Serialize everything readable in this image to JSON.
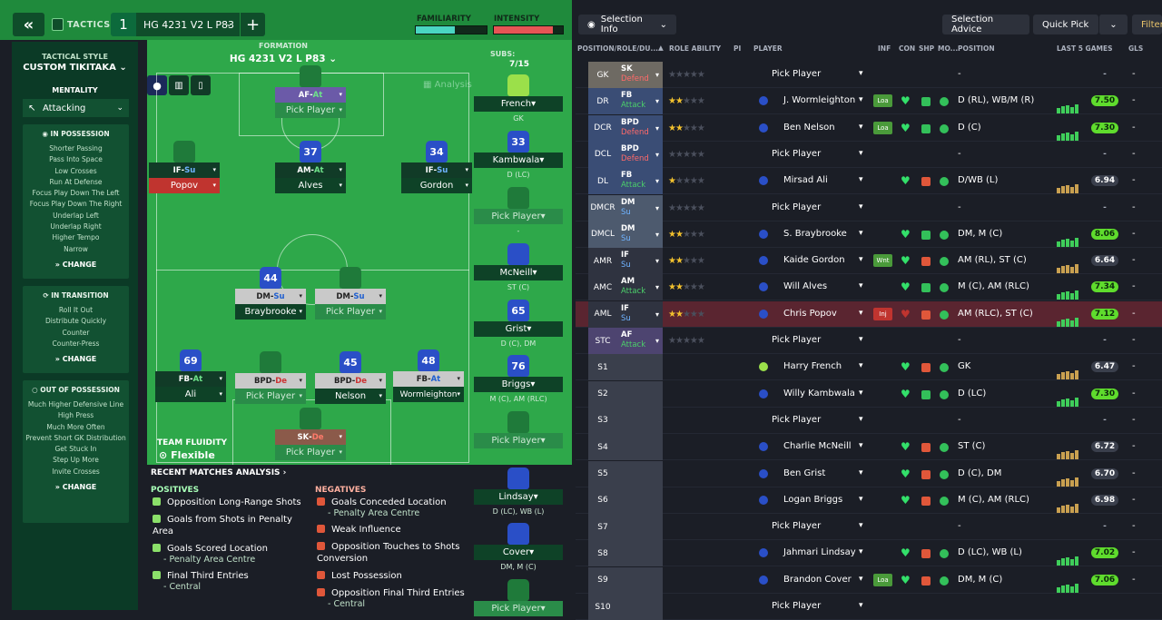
{
  "topbar": {
    "tactics_label": "TACTICS",
    "tactic_num": "1",
    "tactic_name": "HG 4231 V2 L P83",
    "familiarity_label": "FAMILIARITY",
    "intensity_label": "INTENSITY",
    "familiarity_value": 0.55,
    "intensity_value": 0.85
  },
  "left": {
    "style_title": "TACTICAL STYLE",
    "style_value": "CUSTOM TIKITAKA",
    "mentality_title": "MENTALITY",
    "mentality_value": "Attacking",
    "in_possession": {
      "title": "IN POSSESSION",
      "items": [
        "Shorter Passing",
        "Pass Into Space",
        "Low Crosses",
        "Run At Defense",
        "Focus Play Down The Left",
        "Focus Play Down The Right",
        "Underlap Left",
        "Underlap Right",
        "Higher Tempo",
        "Narrow"
      ],
      "change": "CHANGE"
    },
    "in_transition": {
      "title": "IN TRANSITION",
      "items": [
        "Roll It Out",
        "Distribute Quickly",
        "Counter",
        "Counter-Press"
      ],
      "change": "CHANGE"
    },
    "out_possession": {
      "title": "OUT OF POSSESSION",
      "items": [
        "Much Higher Defensive Line",
        "High Press",
        "Much More Often",
        "Prevent Short GK Distribution",
        "Get Stuck In",
        "Step Up More",
        "Invite Crosses"
      ],
      "change": "CHANGE"
    }
  },
  "pitch": {
    "formation_label": "FORMATION",
    "formation_name": "HG 4231 V2 L P83",
    "analysis_label": "Analysis",
    "team_fluidity_label": "TEAM FLUIDITY",
    "team_fluidity_value": "Flexible",
    "subs_label": "SUBS:",
    "subs_count": "7/15",
    "players": [
      {
        "role": "AF",
        "duty": "At",
        "name": "Pick Player",
        "num": ""
      },
      {
        "role": "IF",
        "duty": "Su",
        "name": "Popov",
        "num": ""
      },
      {
        "role": "AM",
        "duty": "At",
        "name": "Alves",
        "num": "37"
      },
      {
        "role": "IF",
        "duty": "Su",
        "name": "Gordon",
        "num": "34"
      },
      {
        "role": "DM",
        "duty": "Su",
        "name": "Braybrooke",
        "num": "44"
      },
      {
        "role": "DM",
        "duty": "Su",
        "name": "Pick Player",
        "num": ""
      },
      {
        "role": "FB",
        "duty": "At",
        "name": "Ali",
        "num": "69"
      },
      {
        "role": "BPD",
        "duty": "De",
        "name": "Pick Player",
        "num": ""
      },
      {
        "role": "BPD",
        "duty": "De",
        "name": "Nelson",
        "num": "45"
      },
      {
        "role": "FB",
        "duty": "At",
        "name": "Wormleighton",
        "num": "48"
      },
      {
        "role": "SK",
        "duty": "De",
        "name": "Pick Player",
        "num": ""
      }
    ],
    "subs": [
      {
        "name": "French",
        "pos": "GK",
        "num": ""
      },
      {
        "name": "Kambwala",
        "pos": "D (LC)",
        "num": "33"
      },
      {
        "name": "Pick Player",
        "pos": "-",
        "num": ""
      },
      {
        "name": "McNeill",
        "pos": "ST (C)",
        "num": ""
      },
      {
        "name": "Grist",
        "pos": "D (C), DM",
        "num": "65"
      },
      {
        "name": "Briggs",
        "pos": "M (C), AM (RLC)",
        "num": "76"
      },
      {
        "name": "Pick Player",
        "pos": "",
        "num": ""
      },
      {
        "name": "Lindsay",
        "pos": "D (LC), WB (L)",
        "num": ""
      },
      {
        "name": "Cover",
        "pos": "DM, M (C)",
        "num": ""
      },
      {
        "name": "Pick Player",
        "pos": "",
        "num": ""
      }
    ]
  },
  "analysis": {
    "title": "RECENT MATCHES ANALYSIS",
    "positives_label": "POSITIVES",
    "negatives_label": "NEGATIVES",
    "positives": [
      {
        "t": "Opposition Long-Range Shots",
        "s": ""
      },
      {
        "t": "Goals from Shots in Penalty Area",
        "s": ""
      },
      {
        "t": "Goals Scored Location",
        "s": "- Penalty Area Centre"
      },
      {
        "t": "Final Third Entries",
        "s": "- Central"
      }
    ],
    "negatives": [
      {
        "t": "Goals Conceded Location",
        "s": "- Penalty Area Centre"
      },
      {
        "t": "Weak Influence",
        "s": ""
      },
      {
        "t": "Opposition Touches to Shots Conversion",
        "s": ""
      },
      {
        "t": "Lost Possession",
        "s": ""
      },
      {
        "t": "Opposition Final Third Entries",
        "s": "- Central"
      }
    ]
  },
  "right": {
    "selection_info": "Selection Info",
    "selection_advice": "Selection Advice",
    "quick_pick": "Quick Pick",
    "filter": "Filter",
    "headers": {
      "pos": "POSITION/ROLE/DU...",
      "ability": "ROLE ABILITY",
      "pi": "PI",
      "player": "PLAYER",
      "inf": "INF",
      "con": "CON",
      "shp": "SHP",
      "mo": "MO...",
      "position": "POSITION",
      "last5": "LAST 5 GAMES",
      "gls": "GLS"
    },
    "rows": [
      {
        "pos": "GK",
        "role": "SK",
        "duty": "Defend",
        "stars": 0,
        "player": "Pick Player",
        "inf": "",
        "posn": "-",
        "rating": "-",
        "gls": "-",
        "kind": "gk"
      },
      {
        "pos": "DR",
        "role": "FB",
        "duty": "Attack",
        "stars": 1.5,
        "player": "J. Wormleighton",
        "inf": "Loa",
        "posn": "D (RL), WB/M (R)",
        "rating": "7.50",
        "gls": "-",
        "kind": "def"
      },
      {
        "pos": "DCR",
        "role": "BPD",
        "duty": "Defend",
        "stars": 1.5,
        "player": "Ben Nelson",
        "inf": "Loa",
        "posn": "D (C)",
        "rating": "7.30",
        "gls": "-",
        "kind": "def"
      },
      {
        "pos": "DCL",
        "role": "BPD",
        "duty": "Defend",
        "stars": 0,
        "player": "Pick Player",
        "inf": "",
        "posn": "-",
        "rating": "-",
        "gls": "-",
        "kind": "def"
      },
      {
        "pos": "DL",
        "role": "FB",
        "duty": "Attack",
        "stars": 1,
        "player": "Mirsad Ali",
        "inf": "",
        "posn": "D/WB (L)",
        "rating": "6.94",
        "gls": "-",
        "kind": "def"
      },
      {
        "pos": "DMCR",
        "role": "DM",
        "duty": "Su",
        "stars": 0,
        "player": "Pick Player",
        "inf": "",
        "posn": "-",
        "rating": "-",
        "gls": "-",
        "kind": "mid"
      },
      {
        "pos": "DMCL",
        "role": "DM",
        "duty": "Su",
        "stars": 1.5,
        "player": "S. Braybrooke",
        "inf": "",
        "posn": "DM, M (C)",
        "rating": "8.06",
        "gls": "-",
        "kind": "mid"
      },
      {
        "pos": "AMR",
        "role": "IF",
        "duty": "Su",
        "stars": 1.5,
        "player": "Kaide Gordon",
        "inf": "Wnt",
        "posn": "AM (RL), ST (C)",
        "rating": "6.64",
        "gls": "-",
        "kind": "att"
      },
      {
        "pos": "AMC",
        "role": "AM",
        "duty": "Attack",
        "stars": 1.5,
        "player": "Will Alves",
        "inf": "",
        "posn": "M (C), AM (RLC)",
        "rating": "7.34",
        "gls": "-",
        "kind": "att"
      },
      {
        "pos": "AML",
        "role": "IF",
        "duty": "Su",
        "stars": 1.5,
        "player": "Chris Popov",
        "inf": "Inj",
        "posn": "AM (RLC), ST (C)",
        "rating": "7.12",
        "gls": "-",
        "kind": "inj"
      },
      {
        "pos": "STC",
        "role": "AF",
        "duty": "Attack",
        "stars": 0,
        "player": "Pick Player",
        "inf": "",
        "posn": "-",
        "rating": "-",
        "gls": "-",
        "kind": "st"
      },
      {
        "pos": "S1",
        "role": "",
        "duty": "",
        "stars": 0,
        "player": "Harry French",
        "inf": "",
        "posn": "GK",
        "rating": "6.47",
        "gls": "-",
        "kind": "sub"
      },
      {
        "pos": "S2",
        "role": "",
        "duty": "",
        "stars": 0,
        "player": "Willy Kambwala",
        "inf": "",
        "posn": "D (LC)",
        "rating": "7.30",
        "gls": "-",
        "kind": "sub"
      },
      {
        "pos": "S3",
        "role": "",
        "duty": "",
        "stars": 0,
        "player": "Pick Player",
        "inf": "",
        "posn": "-",
        "rating": "-",
        "gls": "-",
        "kind": "sub"
      },
      {
        "pos": "S4",
        "role": "",
        "duty": "",
        "stars": 0,
        "player": "Charlie McNeill",
        "inf": "",
        "posn": "ST (C)",
        "rating": "6.72",
        "gls": "-",
        "kind": "sub"
      },
      {
        "pos": "S5",
        "role": "",
        "duty": "",
        "stars": 0,
        "player": "Ben Grist",
        "inf": "",
        "posn": "D (C), DM",
        "rating": "6.70",
        "gls": "-",
        "kind": "sub"
      },
      {
        "pos": "S6",
        "role": "",
        "duty": "",
        "stars": 0,
        "player": "Logan Briggs",
        "inf": "",
        "posn": "M (C), AM (RLC)",
        "rating": "6.98",
        "gls": "-",
        "kind": "sub"
      },
      {
        "pos": "S7",
        "role": "",
        "duty": "",
        "stars": 0,
        "player": "Pick Player",
        "inf": "",
        "posn": "-",
        "rating": "-",
        "gls": "-",
        "kind": "sub"
      },
      {
        "pos": "S8",
        "role": "",
        "duty": "",
        "stars": 0,
        "player": "Jahmari Lindsay",
        "inf": "",
        "posn": "D (LC), WB (L)",
        "rating": "7.02",
        "gls": "-",
        "kind": "sub"
      },
      {
        "pos": "S9",
        "role": "",
        "duty": "",
        "stars": 0,
        "player": "Brandon Cover",
        "inf": "Loa",
        "posn": "DM, M (C)",
        "rating": "7.06",
        "gls": "-",
        "kind": "sub"
      },
      {
        "pos": "S10",
        "role": "",
        "duty": "",
        "stars": 0,
        "player": "Pick Player",
        "inf": "",
        "posn": "",
        "rating": "",
        "gls": "",
        "kind": "sub"
      }
    ]
  },
  "colors": {
    "green_panel": "#2ea84a",
    "dark_green": "#0b3a26",
    "defend": "#e05555",
    "attack": "#4cd06a",
    "support": "#5aa7ff",
    "rating_high": "#5fdc2d",
    "rating_mid": "#3a3f4c",
    "injured_row": "#5a2530"
  }
}
